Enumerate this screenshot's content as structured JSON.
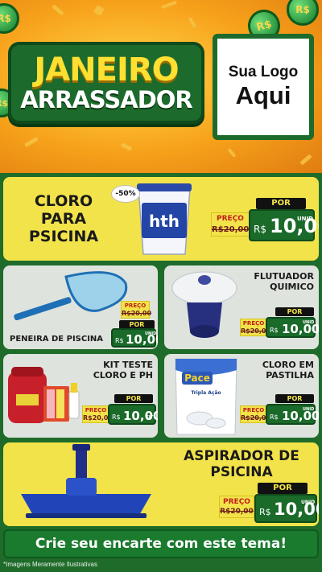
{
  "header": {
    "title_line1": "JANEIRO",
    "title_line2": "ARRASSADOR",
    "logo_line1": "Sua Logo",
    "logo_line2": "Aqui",
    "coin_symbol": "R$"
  },
  "products": [
    {
      "name": "CLORO\nPARA\nPSICINA",
      "por": "POR",
      "preco_label": "PREÇO",
      "old_price": "R$20,00",
      "currency": "R$",
      "new_price": "10,00",
      "unit": "UNID",
      "discount": "-50%",
      "brand": "hth"
    },
    {
      "name": "PENEIRA DE PISCINA",
      "por": "POR",
      "preco_label": "PREÇO",
      "old_price": "R$20,00",
      "currency": "R$",
      "new_price": "10,00",
      "unit": "UNID"
    },
    {
      "name": "FLUTUADOR\nQUIMICO",
      "por": "POR",
      "preco_label": "PREÇO",
      "old_price": "R$20,00",
      "currency": "R$",
      "new_price": "10,00",
      "unit": "UNID"
    },
    {
      "name": "KIT TESTE\nCLORO E PH",
      "por": "POR",
      "preco_label": "PREÇO",
      "old_price": "R$20,00",
      "currency": "R$",
      "new_price": "10,00",
      "unit": "KIT"
    },
    {
      "name": "CLORO EM\nPASTILHA",
      "por": "POR",
      "preco_label": "PREÇO",
      "old_price": "R$20,00",
      "currency": "R$",
      "new_price": "10,00",
      "unit": "UNID",
      "brand": "Pace",
      "brand_sub": "Tripla Ação"
    },
    {
      "name": "ASPIRADOR DE\nPSICINA",
      "por": "POR",
      "preco_label": "PREÇO",
      "old_price": "R$20,00",
      "currency": "R$",
      "new_price": "10,00",
      "unit": "UNID"
    }
  ],
  "footer": {
    "cta": "Crie seu encarte com este tema!",
    "disclaimer": "*Imagens Meramente Ilustrativas"
  },
  "colors": {
    "green": "#1d6b2c",
    "yellow": "#f2e34a",
    "orange": "#f7a21b"
  }
}
